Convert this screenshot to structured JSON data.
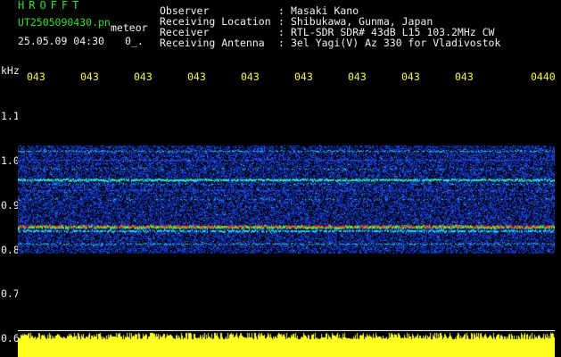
{
  "header": {
    "app_title": "HROFFT",
    "file_name": "UT2505090430.pn",
    "file_suffix": "meteor",
    "date_time": "25.05.09 04:30",
    "frame_code": "0_."
  },
  "metadata": [
    {
      "label": "Observer",
      "value": "Masaki Kano"
    },
    {
      "label": "Receiving Location",
      "value": "Shibukawa, Gunma, Japan"
    },
    {
      "label": "Receiver",
      "value": "RTL-SDR SDR# 43dB L15 103.2MHz CW"
    },
    {
      "label": "Receiving Antenna",
      "value": "3el Yagi(V) Az 330 for Vladivostok"
    }
  ],
  "metadata_separator": ":",
  "axis": {
    "unit": "kHz",
    "time_ticks": [
      "043",
      "043",
      "043",
      "043",
      "043",
      "043",
      "043",
      "043",
      "043",
      "0440"
    ],
    "freq_ticks": [
      "1.1",
      "1.0",
      "0.9",
      "0.8",
      "0.7",
      "0.6"
    ]
  },
  "spectrogram": {
    "bands_khz": [
      1.02,
      1.0,
      0.98,
      0.955,
      0.945,
      0.93,
      0.91,
      0.85,
      0.84,
      0.81
    ],
    "signal_colors": {
      "noise": "#0b2ca8",
      "dense": "#2a55ff",
      "cyan": "#1fd8e0",
      "green": "#3cff40",
      "red": "#ff2626"
    }
  },
  "colors": {
    "background": "#000000",
    "header_title": "#2ee02e",
    "label_text": "#f2f2f2",
    "time_ticks": "#ffff20",
    "amplitude": "#ffff20"
  }
}
